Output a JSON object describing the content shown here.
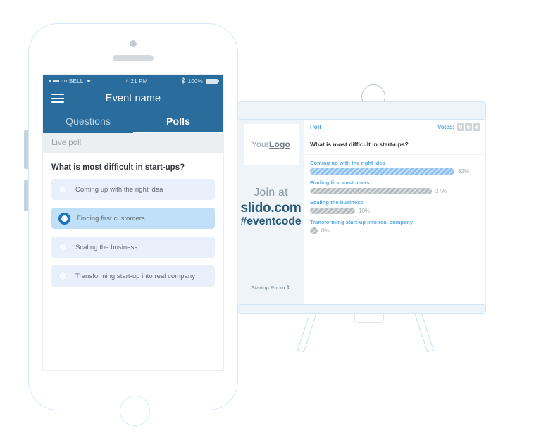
{
  "phone": {
    "status_bar": {
      "carrier": "BELL",
      "time": "4:21 PM",
      "battery": "100%",
      "wifi_icon": "wifi-icon",
      "bluetooth_icon": "bluetooth-icon",
      "signal_dots_filled": 3,
      "signal_dots_empty": 2
    },
    "nav": {
      "menu_icon": "hamburger-menu-icon",
      "title": "Event name"
    },
    "tabs": [
      {
        "label": "Questions",
        "active": false
      },
      {
        "label": "Polls",
        "active": true
      }
    ],
    "section_label": "Live poll",
    "question": "What is most difficult in start-ups?",
    "choices": [
      {
        "label": "Coming up with the right idea",
        "selected": false
      },
      {
        "label": "Finding first customers",
        "selected": true
      },
      {
        "label": "Scaling the business",
        "selected": false
      },
      {
        "label": "Transforming start-up into real company",
        "selected": false
      }
    ]
  },
  "projector": {
    "sidebar": {
      "logo_prefix": "Your",
      "logo_bold": "Logo",
      "join_at": "Join at",
      "url": "slido.com",
      "event_code": "#eventcode",
      "room": "Startup Room",
      "room_toggle_icon": "up-down-arrow-icon"
    },
    "header": {
      "tab_label": "Poll",
      "votes_label": "Votes:",
      "votes_digits": [
        "0",
        "6",
        "4"
      ]
    },
    "question": "What is most difficult in start-ups?",
    "results": [
      {
        "label": "Coming up with the right idea",
        "percent": "32%"
      },
      {
        "label": "Finding first customers",
        "percent": "27%"
      },
      {
        "label": "Scaling the business",
        "percent": "10%"
      },
      {
        "label": "Transforming start-up into real company",
        "percent": "0%"
      }
    ]
  },
  "chart_data": {
    "type": "bar",
    "title": "What is most difficult in start-ups?",
    "categories": [
      "Coming up with the right idea",
      "Finding first customers",
      "Scaling the business",
      "Transforming start-up into real company"
    ],
    "values": [
      32,
      27,
      10,
      0
    ],
    "value_labels": [
      "32%",
      "27%",
      "10%",
      "0%"
    ],
    "unit": "percent",
    "total_votes": "064",
    "xlabel": "",
    "ylabel": "",
    "xlim": [
      0,
      100
    ],
    "grid": false,
    "legend": false,
    "orientation": "horizontal",
    "series_colors": [
      "#8cc0f2",
      "#b6bbbe",
      "#b6bbbe",
      "#b6bbbe"
    ]
  },
  "colors": {
    "brand_blue": "#2a6d9c",
    "accent_blue": "#4ba3e3",
    "bar_blue": "#8cc0f2",
    "bar_gray": "#b6bbbe",
    "selected_row": "#bfe0f8",
    "row_bg": "#eaf0fb",
    "device_outline": "#d4e9f8"
  }
}
